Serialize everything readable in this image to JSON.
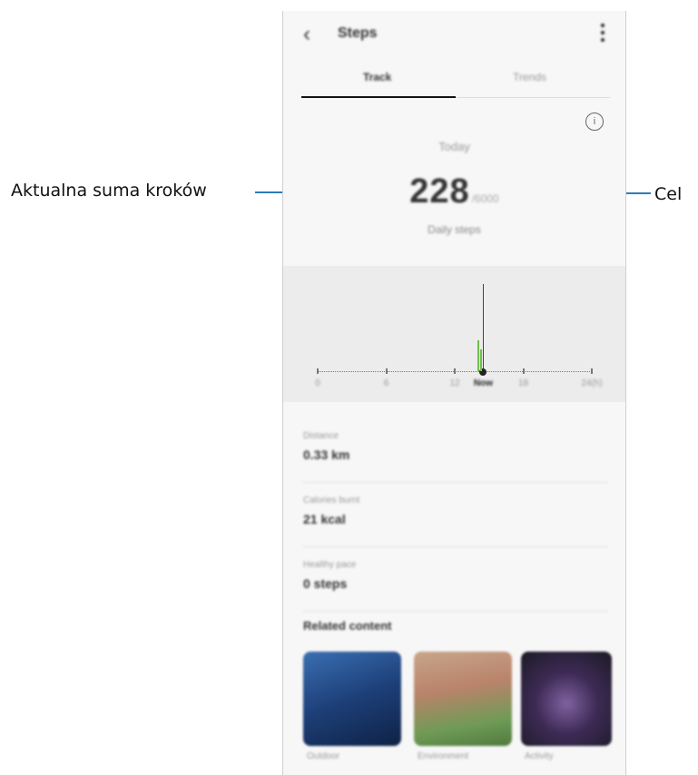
{
  "annotations": {
    "left_label": "Aktualna suma kroków",
    "right_label": "Cel"
  },
  "header": {
    "back_icon": "chevron-left-icon",
    "title": "Steps",
    "more_icon": "more-vertical-icon"
  },
  "tabs": [
    {
      "label": "Track",
      "active": true
    },
    {
      "label": "Trends",
      "active": false
    }
  ],
  "info_icon": "info-icon",
  "summary": {
    "period_label": "Today",
    "steps_count": "228",
    "steps_goal": "/6000",
    "daily_steps_label": "Daily steps"
  },
  "chart_data": {
    "type": "bar",
    "x_tick_labels": [
      "0",
      "6",
      "12",
      "Now",
      "18",
      "24(h)"
    ],
    "x": [
      0,
      6,
      12,
      14.5,
      18,
      24
    ],
    "xlim": [
      0,
      24
    ],
    "series": [
      {
        "hours": [
          14.0,
          14.2
        ],
        "relative_values": [
          0.35,
          0.25
        ]
      }
    ],
    "now_marker_hour": 14.5,
    "colors": {
      "bars": "#6fbd4e",
      "now_line": "#444444"
    }
  },
  "stats": [
    {
      "label": "Distance",
      "value": "0.33 km"
    },
    {
      "label": "Calories burnt",
      "value": "21 kcal"
    },
    {
      "label": "Healthy pace",
      "value": "0 steps"
    }
  ],
  "related": {
    "title": "Related content",
    "items": [
      {
        "label": "Outdoor"
      },
      {
        "label": "Environment"
      },
      {
        "label": "Activity"
      }
    ]
  },
  "colors": {
    "leader_line": "#2b7cb8",
    "accent_green": "#6fbd4e"
  }
}
